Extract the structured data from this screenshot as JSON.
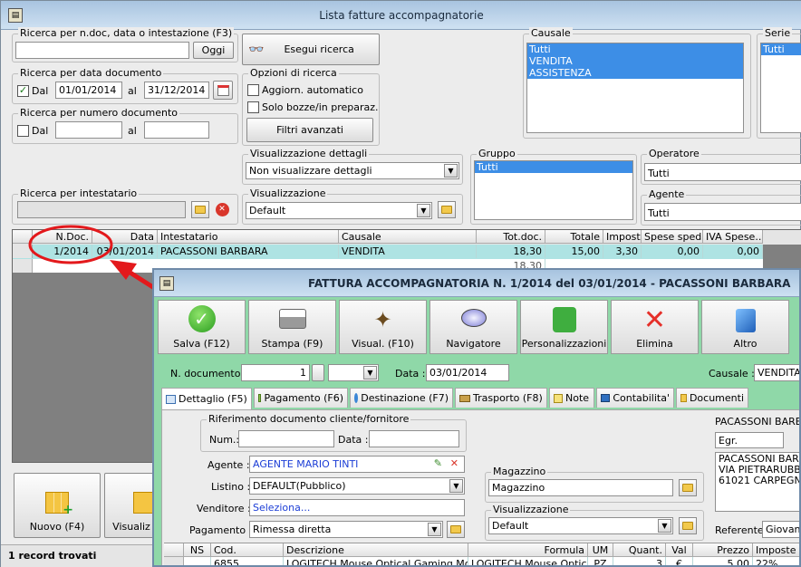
{
  "main": {
    "title": "Lista fatture accompagnatorie",
    "search_ndoc": {
      "label": "Ricerca per n.doc, data o intestazione (F3)",
      "value": "",
      "button": "Oggi"
    },
    "search_button": "Esegui ricerca",
    "by_date": {
      "label": "Ricerca per data documento",
      "dal_label": "Dal",
      "from": "01/01/2014",
      "al_label": "al",
      "to": "31/12/2014"
    },
    "by_number": {
      "label": "Ricerca per numero documento",
      "dal_label": "Dal",
      "from": "",
      "al_label": "al",
      "to": ""
    },
    "options": {
      "label": "Opzioni di ricerca",
      "auto_update": "Aggiorn. automatico",
      "drafts_only": "Solo bozze/in preparaz.",
      "filters_button": "Filtri avanzati"
    },
    "by_holder": {
      "label": "Ricerca per intestatario",
      "value": ""
    },
    "details_view": {
      "label": "Visualizzazione dettagli",
      "value": "Non visualizzare dettagli"
    },
    "view": {
      "label": "Visualizzazione",
      "value": "Default"
    },
    "causale": {
      "label": "Causale",
      "items": [
        "Tutti",
        "VENDITA",
        "ASSISTENZA"
      ]
    },
    "serie": {
      "label": "Serie",
      "items": [
        "Tutti"
      ]
    },
    "gruppo": {
      "label": "Gruppo",
      "items": [
        "Tutti"
      ]
    },
    "operatore": {
      "label": "Operatore",
      "value": "Tutti"
    },
    "agente": {
      "label": "Agente",
      "value": "Tutti"
    },
    "table": {
      "headers": [
        "N.Doc.",
        "Data",
        "Intestatario",
        "Causale",
        "Tot.doc.",
        "Totale",
        "Imposte",
        "Spese sped.",
        "IVA Spese..."
      ],
      "row": {
        "ndoc": "1/2014",
        "data": "03/01/2014",
        "intestatario": "PACASSONI BARBARA",
        "causale": "VENDITA",
        "totdoc": "18,30",
        "totale": "15,00",
        "imposte": "3,30",
        "spese": "0,00",
        "iva_spese": "0,00"
      },
      "footer_total": "18,30"
    },
    "bottom_buttons": {
      "new": "Nuovo (F4)",
      "view": "Visualiz"
    },
    "status": "1 record trovati"
  },
  "doc": {
    "title": "FATTURA ACCOMPAGNATORIA N. 1/2014 del 03/01/2014 - PACASSONI BARBARA",
    "toolbar": [
      "Salva (F12)",
      "Stampa (F9)",
      "Visual. (F10)",
      "Navigatore",
      "Personalizzazioni",
      "Elimina",
      "Altro"
    ],
    "ndoc_label": "N. documento :",
    "ndoc_value": "1",
    "data_label": "Data :",
    "data_value": "03/01/2014",
    "causale_label": "Causale :",
    "causale_value": "VENDITA",
    "tabs": [
      "Dettaglio (F5)",
      "Pagamento (F6)",
      "Destinazione (F7)",
      "Trasporto (F8)",
      "Note",
      "Contabilita'",
      "Documenti"
    ],
    "rif": {
      "label": "Riferimento documento cliente/fornitore",
      "num_label": "Num.:",
      "num_value": "",
      "data_label": "Data :",
      "data_value": ""
    },
    "agente_label": "Agente :",
    "agente_value": "AGENTE MARIO TINTI",
    "listino_label": "Listino :",
    "listino_value": "DEFAULT(Pubblico)",
    "venditore_label": "Venditore :",
    "venditore_value": "Seleziona...",
    "pagamento_label": "Pagamento :",
    "pagamento_value": "Rimessa diretta",
    "magazzino": {
      "label": "Magazzino",
      "value": "Magazzino"
    },
    "visualizzazione": {
      "label": "Visualizzazione",
      "value": "Default"
    },
    "cliente": {
      "name": "PACASSONI BARBA",
      "greeting": "Egr.",
      "address": [
        "PACASSONI BARBA",
        "VIA PIETRARUBBIA",
        "61021 CARPEGNA ("
      ]
    },
    "referente_label": "Referente",
    "referente_value": "Giovann",
    "grid_headers": [
      "NS",
      "Cod.",
      "Descrizione",
      "Formula",
      "UM",
      "Quant.",
      "Val",
      "Prezzo",
      "Imposte"
    ],
    "grid_row": [
      "",
      "6855",
      "LOGITECH Mouse Optical Gaming Mou...",
      "LOGITECH Mouse Optic...",
      "PZ",
      "3",
      "€",
      "5,00",
      "22%"
    ]
  }
}
